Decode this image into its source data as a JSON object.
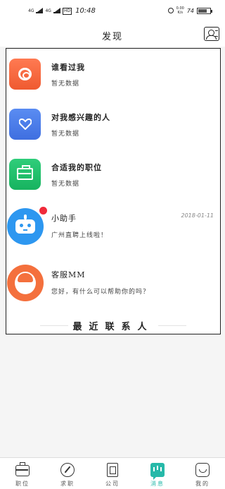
{
  "status_bar": {
    "signal_1": "4G",
    "signal_2": "4G",
    "hd": "HD",
    "time": "10:48",
    "net_speed_value": "0.00",
    "net_speed_unit": "K/s",
    "battery_text": "74",
    "battery_level": 74
  },
  "header": {
    "title": "发现"
  },
  "messages": [
    {
      "title": "谁看过我",
      "subtitle": "暂无数据",
      "icon": "eye-icon",
      "color": "#f2643a"
    },
    {
      "title": "对我感兴趣的人",
      "subtitle": "暂无数据",
      "icon": "heart-icon",
      "color": "#4a7ee8"
    },
    {
      "title": "合适我的职位",
      "subtitle": "暂无数据",
      "icon": "briefcase-icon",
      "color": "#22c06b"
    },
    {
      "title": "小助手",
      "subtitle": "广州直聘上线啦！",
      "date": "2018-01-11",
      "icon": "robot-icon",
      "color": "#2d97f0"
    },
    {
      "title": "客服MM",
      "subtitle": "您好，有什么可以帮助你的吗？",
      "icon": "service-avatar-icon",
      "color": "#f4703d"
    }
  ],
  "recent_contacts_label": "最近联系人",
  "bottom_nav": [
    {
      "label": "职位",
      "icon": "briefcase-icon"
    },
    {
      "label": "求职",
      "icon": "compass-icon"
    },
    {
      "label": "公司",
      "icon": "company-icon"
    },
    {
      "label": "消息",
      "icon": "message-icon",
      "active": true
    },
    {
      "label": "我的",
      "icon": "profile-icon"
    }
  ],
  "colors": {
    "accent": "#26b9a9",
    "unread": "#f02a3a"
  }
}
